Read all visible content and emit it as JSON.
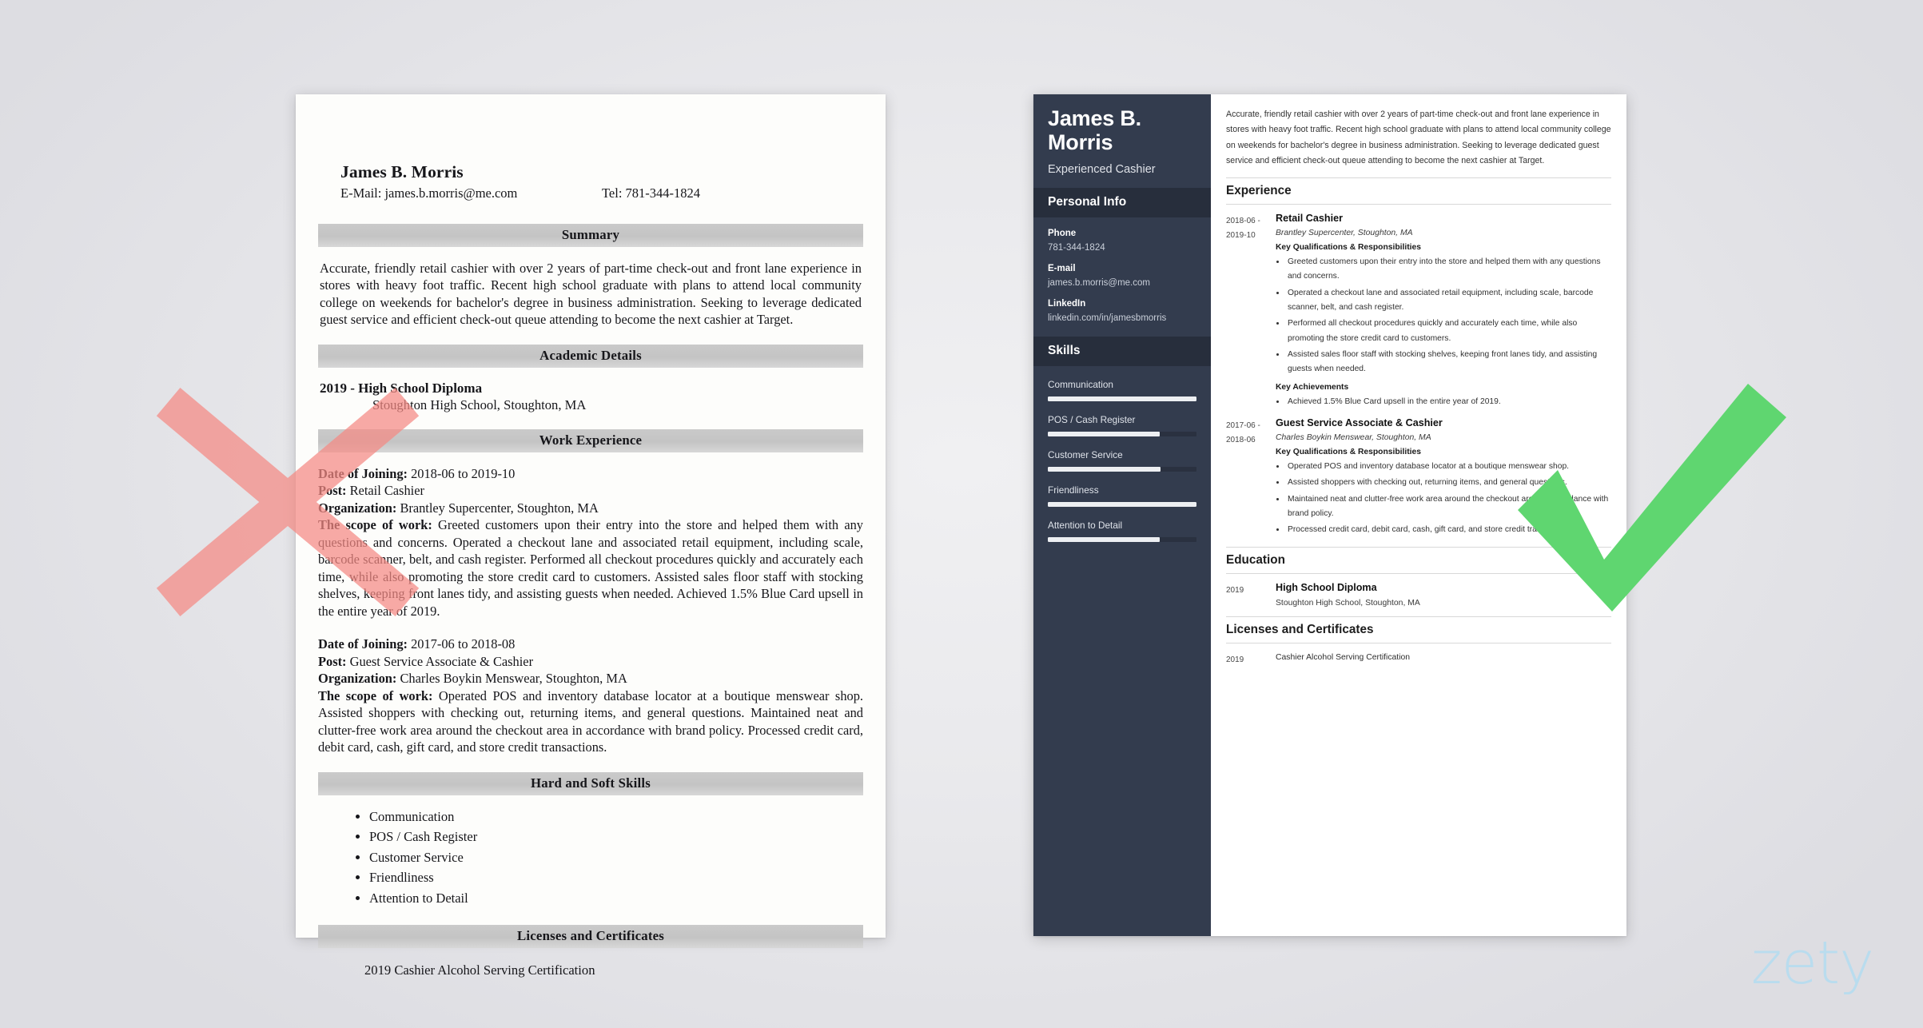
{
  "background": {
    "page_bg": "#e9e9ec"
  },
  "brand": {
    "logo_text": "zety",
    "logo_color": "#b6dcf0"
  },
  "marks": {
    "reject": {
      "name": "red-x-mark",
      "color": "#f58a84"
    },
    "approve": {
      "name": "green-check-mark",
      "color": "#5fd670"
    }
  },
  "bad_resume": {
    "name": "James B. Morris",
    "email_line": "E-Mail: james.b.morris@me.com",
    "phone_line": "Tel: 781-344-1824",
    "sections": {
      "summary_heading": "Summary",
      "summary_text": "Accurate, friendly retail cashier with over 2 years of part-time check-out and front lane experience in stores with heavy foot traffic. Recent high school graduate with plans to attend local community college on weekends for bachelor's degree in business administration. Seeking to leverage dedicated guest service and efficient check-out queue attending to become the next cashier at Target.",
      "academic_heading": "Academic Details",
      "academic_degree": "2019 - High School Diploma",
      "academic_school": "Stoughton High School, Stoughton, MA",
      "work_heading": "Work Experience",
      "skills_heading": "Hard and Soft Skills",
      "licenses_heading": "Licenses and Certificates",
      "license_item": "2019 Cashier Alcohol Serving Certification"
    },
    "jobs": [
      {
        "date_label": "Date of Joining:",
        "date_value": " 2018-06 to 2019-10",
        "post_label": "Post:",
        "post_value": " Retail Cashier",
        "org_label": "Organization:",
        "org_value": " Brantley Supercenter, Stoughton, MA",
        "scope_label": "The scope of work:",
        "scope_value": " Greeted customers upon their entry into the store and helped them with any questions and concerns. Operated a checkout lane and associated retail equipment, including scale, barcode scanner, belt, and cash register. Performed all checkout procedures quickly and accurately each time, while also promoting the store credit card to customers. Assisted sales floor staff with stocking shelves, keeping front lanes tidy, and assisting guests when needed. Achieved 1.5% Blue Card upsell in the entire year of 2019."
      },
      {
        "date_label": "Date of Joining:",
        "date_value": " 2017-06 to 2018-08",
        "post_label": "Post:",
        "post_value": " Guest Service Associate & Cashier",
        "org_label": "Organization:",
        "org_value": " Charles Boykin Menswear, Stoughton, MA",
        "scope_label": "The scope of work:",
        "scope_value": " Operated POS and inventory database locator at a boutique menswear shop. Assisted shoppers with checking out, returning items, and general questions. Maintained neat and clutter-free work area around the checkout area in accordance with brand policy. Processed credit card, debit card, cash, gift card, and store credit transactions."
      }
    ],
    "skills": [
      "Communication",
      "POS / Cash Register",
      "Customer Service",
      "Friendliness",
      "Attention to Detail"
    ]
  },
  "good_resume": {
    "sidebar": {
      "name": "James B. Morris",
      "job_title": "Experienced Cashier",
      "personal_info_heading": "Personal Info",
      "fields": [
        {
          "label": "Phone",
          "value": "781-344-1824"
        },
        {
          "label": "E-mail",
          "value": "james.b.morris@me.com"
        },
        {
          "label": "LinkedIn",
          "value": "linkedin.com/in/jamesbmorris"
        }
      ],
      "skills_heading": "Skills",
      "skills": [
        {
          "name": "Communication",
          "level": 100
        },
        {
          "name": "POS / Cash Register",
          "level": 75
        },
        {
          "name": "Customer Service",
          "level": 76
        },
        {
          "name": "Friendliness",
          "level": 100
        },
        {
          "name": "Attention to Detail",
          "level": 75
        }
      ]
    },
    "main": {
      "summary": "Accurate, friendly retail cashier with over 2 years of part-time check-out and front lane experience in stores with heavy foot traffic. Recent high school graduate with plans to attend local community college on weekends for bachelor's degree in business administration. Seeking to leverage dedicated guest service and efficient check-out queue attending to become the next cashier at Target.",
      "experience_heading": "Experience",
      "experience": [
        {
          "date_from": "2018-06 -",
          "date_to": "2019-10",
          "role": "Retail Cashier",
          "org": "Brantley Supercenter, Stoughton, MA",
          "quals_heading": "Key Qualifications & Responsibilities",
          "bullets": [
            "Greeted customers upon their entry into the store and helped them with any questions and concerns.",
            "Operated a checkout lane and associated retail equipment, including scale, barcode scanner, belt, and cash register.",
            "Performed all checkout procedures quickly and accurately each time, while also promoting the store credit card to customers.",
            "Assisted sales floor staff with stocking shelves, keeping front lanes tidy, and assisting guests when needed."
          ],
          "achievements_heading": "Key Achievements",
          "achievements": [
            "Achieved 1.5% Blue Card upsell in the entire year of 2019."
          ]
        },
        {
          "date_from": "2017-06 -",
          "date_to": "2018-06",
          "role": "Guest Service Associate & Cashier",
          "org": "Charles Boykin Menswear, Stoughton, MA",
          "quals_heading": "Key Qualifications & Responsibilities",
          "bullets": [
            "Operated POS and inventory database locator at a boutique menswear shop.",
            "Assisted shoppers with checking out, returning items, and general questions.",
            "Maintained neat and clutter-free work area around the checkout area in accordance with brand policy.",
            "Processed credit card, debit card, cash, gift card, and store credit transactions."
          ],
          "achievements_heading": "",
          "achievements": []
        }
      ],
      "education_heading": "Education",
      "education": [
        {
          "year": "2019",
          "degree": "High School Diploma",
          "school": "Stoughton High School, Stoughton, MA"
        }
      ],
      "licenses_heading": "Licenses and Certificates",
      "licenses": [
        {
          "year": "2019",
          "title": "Cashier Alcohol Serving Certification"
        }
      ]
    }
  }
}
